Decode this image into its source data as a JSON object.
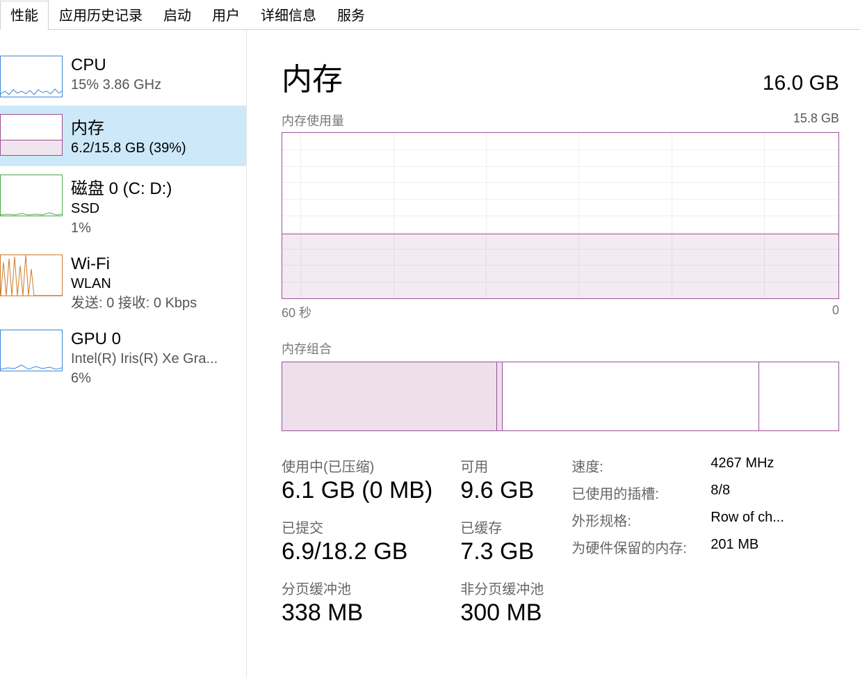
{
  "tabs": [
    "性能",
    "应用历史记录",
    "启动",
    "用户",
    "详细信息",
    "服务"
  ],
  "activeTabIndex": 0,
  "sidebar": {
    "cpu": {
      "title": "CPU",
      "sub": "15% 3.86 GHz"
    },
    "mem": {
      "title": "内存",
      "sub": "6.2/15.8 GB (39%)"
    },
    "disk": {
      "title": "磁盘 0 (C: D:)",
      "sub1": "SSD",
      "sub2": "1%"
    },
    "wifi": {
      "title": "Wi-Fi",
      "sub1": "WLAN",
      "sub2": "发送: 0 接收: 0 Kbps"
    },
    "gpu": {
      "title": "GPU 0",
      "sub1": "Intel(R) Iris(R) Xe Gra...",
      "sub2": "6%"
    }
  },
  "detail": {
    "title": "内存",
    "total": "16.0 GB",
    "usage_label": "内存使用量",
    "usage_max": "15.8 GB",
    "axis_left": "60 秒",
    "axis_right": "0",
    "composition_label": "内存组合",
    "in_use_label": "使用中(已压缩)",
    "in_use_value": "6.1 GB (0 MB)",
    "available_label": "可用",
    "available_value": "9.6 GB",
    "committed_label": "已提交",
    "committed_value": "6.9/18.2 GB",
    "cached_label": "已缓存",
    "cached_value": "7.3 GB",
    "paged_label": "分页缓冲池",
    "paged_value": "338 MB",
    "nonpaged_label": "非分页缓冲池",
    "nonpaged_value": "300 MB",
    "speed_label": "速度:",
    "speed_value": "4267 MHz",
    "slots_label": "已使用的插槽:",
    "slots_value": "8/8",
    "form_label": "外形规格:",
    "form_value": "Row of ch...",
    "reserved_label": "为硬件保留的内存:",
    "reserved_value": "201 MB"
  },
  "chart_data": {
    "type": "area",
    "title": "内存使用量",
    "xlabel": "",
    "ylabel": "",
    "ylim": [
      0,
      15.8
    ],
    "x_range_seconds": 60,
    "values_gb_constant": 6.2,
    "composition_gb": {
      "in_use": 6.1,
      "modified": 0.15,
      "standby": 7.3,
      "free": 2.25,
      "total": 15.8
    }
  }
}
